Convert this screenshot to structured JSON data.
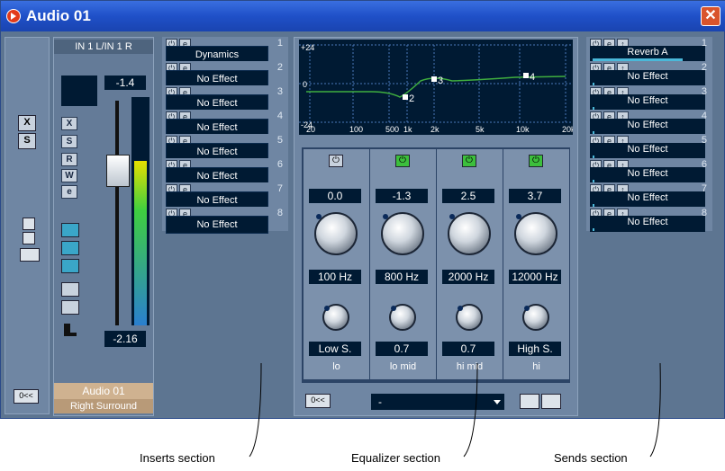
{
  "window": {
    "title": "Audio 01",
    "close_glyph": "✕"
  },
  "channel": {
    "routing": "IN 1 L/IN 1 R",
    "top_value": "-1.4",
    "fader_value": "-2.16",
    "name": "Audio 01",
    "output": "Right Surround",
    "buttons": [
      "X",
      "S",
      "R",
      "W",
      "e"
    ],
    "footer_btn": "0<<",
    "meter_level": 0.72
  },
  "left_strip": {
    "x_label": "X",
    "s_label": "S",
    "footer_btn": "0<<"
  },
  "inserts": {
    "slots": [
      {
        "num": "1",
        "name": "Dynamics"
      },
      {
        "num": "2",
        "name": "No Effect"
      },
      {
        "num": "3",
        "name": "No Effect"
      },
      {
        "num": "4",
        "name": "No Effect"
      },
      {
        "num": "5",
        "name": "No Effect"
      },
      {
        "num": "6",
        "name": "No Effect"
      },
      {
        "num": "7",
        "name": "No Effect"
      },
      {
        "num": "8",
        "name": "No Effect"
      }
    ]
  },
  "eq": {
    "graph": {
      "y_top": "+24",
      "y_mid": "0",
      "y_bottom": "-24",
      "x_ticks": [
        "20",
        "100",
        "500",
        "1k",
        "2k",
        "5k",
        "10k",
        "20k"
      ],
      "points": [
        "2",
        "3",
        "4"
      ]
    },
    "bands": [
      {
        "gain": "0.0",
        "freq": "100 Hz",
        "q": "Low S.",
        "label": "lo",
        "enabled": false
      },
      {
        "gain": "-1.3",
        "freq": "800 Hz",
        "q": "0.7",
        "label": "lo mid",
        "enabled": true
      },
      {
        "gain": "2.5",
        "freq": "2000 Hz",
        "q": "0.7",
        "label": "hi mid",
        "enabled": true
      },
      {
        "gain": "3.7",
        "freq": "12000 Hz",
        "q": "High S.",
        "label": "hi",
        "enabled": true
      }
    ],
    "footer_btn": "0<<",
    "preset": "-"
  },
  "sends": {
    "slots": [
      {
        "num": "1",
        "name": "Reverb A",
        "level": 0.82
      },
      {
        "num": "2",
        "name": "No Effect",
        "level": 0.02
      },
      {
        "num": "3",
        "name": "No Effect",
        "level": 0.02
      },
      {
        "num": "4",
        "name": "No Effect",
        "level": 0.02
      },
      {
        "num": "5",
        "name": "No Effect",
        "level": 0.02
      },
      {
        "num": "6",
        "name": "No Effect",
        "level": 0.02
      },
      {
        "num": "7",
        "name": "No Effect",
        "level": 0.02
      },
      {
        "num": "8",
        "name": "No Effect",
        "level": 0.02
      }
    ]
  },
  "captions": {
    "inserts": "Inserts section",
    "equalizer": "Equalizer section",
    "sends": "Sends section"
  },
  "colors": {
    "title_bar": "#1f50c8",
    "panel": "#6f86a3",
    "display": "#001a33",
    "eq_curve": "#3fae3f",
    "power_on": "#3cbf3c"
  }
}
